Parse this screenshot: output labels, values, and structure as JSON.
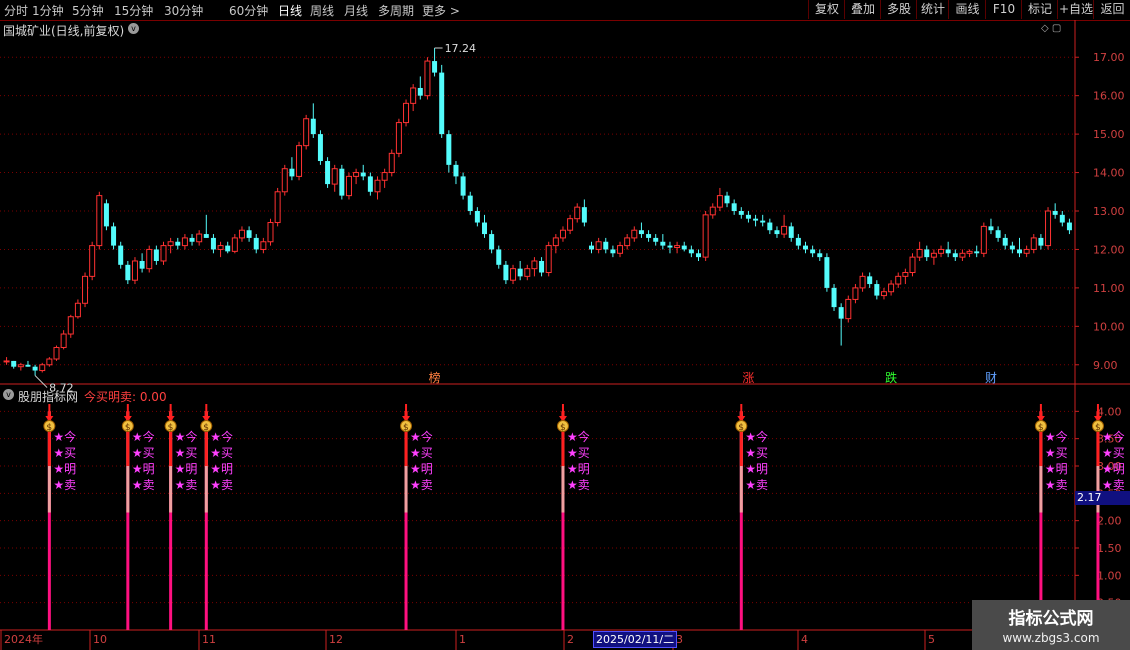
{
  "toolbar": {
    "periods": [
      "分时",
      "1分钟",
      "5分钟",
      "15分钟",
      "30分钟",
      "60分钟",
      "日线",
      "周线",
      "月线",
      "多周期",
      "更多 >"
    ],
    "active_period": "日线",
    "buttons": [
      "复权",
      "叠加",
      "多股",
      "统计",
      "画线",
      "F10",
      "标记",
      "+自选",
      "返回"
    ]
  },
  "stock": {
    "title": "国城矿业(日线,前复权)",
    "toggle": "v"
  },
  "indicator": {
    "name": "股朋指标网",
    "value_text": "今买明卖: 0.00",
    "toggle": "v"
  },
  "corner_icons": "◇ ▢",
  "date_cursor": "2025/02/11/二",
  "value_tag": "2.17",
  "watermark": {
    "title": "指标公式网",
    "url": "www.zbgs3.com"
  },
  "colors": {
    "up": "#ff3232",
    "down": "#54fcfc",
    "grid": "#7a0000",
    "axis": "#cc2020"
  },
  "chart_data": {
    "type": "candlestick",
    "price_axis": {
      "ticks": [
        "17.00",
        "16.00",
        "15.00",
        "14.00",
        "13.00",
        "12.00",
        "11.00",
        "10.00",
        "9.00"
      ],
      "ylim": [
        8.5,
        17.5
      ]
    },
    "indicator_axis": {
      "ticks": [
        "4.00",
        "3.50",
        "3.00",
        "2.50",
        "2.00",
        "1.50",
        "1.00",
        "0.50"
      ],
      "ylim": [
        0,
        4.5
      ]
    },
    "time_axis": [
      "2024年",
      "10",
      "11",
      "12",
      "1",
      "2",
      "3",
      "4",
      "5"
    ],
    "high_label": "17.24",
    "low_label": "8.72",
    "candles": [
      [
        9.1,
        9.2,
        9.0,
        9.1
      ],
      [
        9.1,
        9.1,
        8.9,
        8.95
      ],
      [
        8.95,
        9.05,
        8.85,
        9.0
      ],
      [
        9.0,
        9.1,
        8.95,
        8.95
      ],
      [
        8.95,
        9.0,
        8.72,
        8.85
      ],
      [
        8.85,
        9.05,
        8.8,
        9.0
      ],
      [
        9.0,
        9.2,
        8.95,
        9.15
      ],
      [
        9.15,
        9.5,
        9.1,
        9.45
      ],
      [
        9.45,
        9.9,
        9.4,
        9.8
      ],
      [
        9.8,
        10.3,
        9.7,
        10.25
      ],
      [
        10.25,
        10.7,
        10.2,
        10.6
      ],
      [
        10.6,
        11.4,
        10.5,
        11.3
      ],
      [
        11.3,
        12.2,
        11.2,
        12.1
      ],
      [
        12.1,
        13.5,
        12.0,
        13.4
      ],
      [
        13.2,
        13.3,
        12.5,
        12.6
      ],
      [
        12.6,
        12.7,
        12.0,
        12.1
      ],
      [
        12.1,
        12.2,
        11.5,
        11.6
      ],
      [
        11.6,
        11.7,
        11.1,
        11.2
      ],
      [
        11.2,
        11.8,
        11.1,
        11.7
      ],
      [
        11.7,
        11.9,
        11.4,
        11.5
      ],
      [
        11.5,
        12.1,
        11.4,
        12.0
      ],
      [
        12.0,
        12.1,
        11.6,
        11.7
      ],
      [
        11.7,
        12.2,
        11.6,
        12.1
      ],
      [
        12.1,
        12.3,
        11.9,
        12.2
      ],
      [
        12.2,
        12.3,
        12.0,
        12.1
      ],
      [
        12.1,
        12.4,
        12.0,
        12.3
      ],
      [
        12.3,
        12.4,
        12.1,
        12.2
      ],
      [
        12.2,
        12.5,
        12.1,
        12.4
      ],
      [
        12.4,
        12.9,
        12.3,
        12.3
      ],
      [
        12.3,
        12.4,
        11.9,
        12.0
      ],
      [
        12.0,
        12.2,
        11.8,
        12.1
      ],
      [
        12.1,
        12.2,
        11.9,
        11.95
      ],
      [
        11.95,
        12.4,
        11.9,
        12.3
      ],
      [
        12.3,
        12.6,
        12.2,
        12.5
      ],
      [
        12.5,
        12.6,
        12.2,
        12.3
      ],
      [
        12.3,
        12.4,
        11.9,
        12.0
      ],
      [
        12.0,
        12.3,
        11.9,
        12.2
      ],
      [
        12.2,
        12.8,
        12.1,
        12.7
      ],
      [
        12.7,
        13.6,
        12.6,
        13.5
      ],
      [
        13.5,
        14.2,
        13.4,
        14.1
      ],
      [
        14.1,
        14.4,
        13.8,
        13.9
      ],
      [
        13.9,
        14.8,
        13.8,
        14.7
      ],
      [
        14.7,
        15.5,
        14.6,
        15.4
      ],
      [
        15.4,
        15.8,
        14.9,
        15.0
      ],
      [
        15.0,
        15.1,
        14.2,
        14.3
      ],
      [
        14.3,
        14.4,
        13.6,
        13.7
      ],
      [
        13.7,
        14.2,
        13.5,
        14.1
      ],
      [
        14.1,
        14.2,
        13.3,
        13.4
      ],
      [
        13.4,
        14.0,
        13.3,
        13.9
      ],
      [
        13.9,
        14.1,
        13.7,
        14.0
      ],
      [
        14.0,
        14.2,
        13.8,
        13.9
      ],
      [
        13.9,
        14.0,
        13.4,
        13.5
      ],
      [
        13.5,
        13.9,
        13.3,
        13.8
      ],
      [
        13.8,
        14.1,
        13.6,
        14.0
      ],
      [
        14.0,
        14.6,
        13.9,
        14.5
      ],
      [
        14.5,
        15.4,
        14.4,
        15.3
      ],
      [
        15.3,
        15.9,
        15.2,
        15.8
      ],
      [
        15.8,
        16.3,
        15.6,
        16.2
      ],
      [
        16.2,
        16.5,
        15.9,
        16.0
      ],
      [
        16.0,
        17.0,
        15.9,
        16.9
      ],
      [
        16.9,
        17.24,
        16.5,
        16.6
      ],
      [
        16.6,
        16.8,
        14.9,
        15.0
      ],
      [
        15.0,
        15.1,
        14.0,
        14.2
      ],
      [
        14.2,
        14.3,
        13.7,
        13.9
      ],
      [
        13.9,
        14.0,
        13.3,
        13.4
      ],
      [
        13.4,
        13.5,
        12.9,
        13.0
      ],
      [
        13.0,
        13.1,
        12.6,
        12.7
      ],
      [
        12.7,
        12.9,
        12.3,
        12.4
      ],
      [
        12.4,
        12.5,
        11.9,
        12.0
      ],
      [
        12.0,
        12.1,
        11.5,
        11.6
      ],
      [
        11.6,
        11.7,
        11.1,
        11.2
      ],
      [
        11.2,
        11.6,
        11.1,
        11.5
      ],
      [
        11.5,
        11.7,
        11.2,
        11.3
      ],
      [
        11.3,
        11.6,
        11.2,
        11.5
      ],
      [
        11.5,
        11.8,
        11.3,
        11.7
      ],
      [
        11.7,
        11.8,
        11.3,
        11.4
      ],
      [
        11.4,
        12.2,
        11.3,
        12.1
      ],
      [
        12.1,
        12.4,
        11.9,
        12.3
      ],
      [
        12.3,
        12.6,
        12.2,
        12.5
      ],
      [
        12.5,
        12.9,
        12.4,
        12.8
      ],
      [
        12.8,
        13.2,
        12.7,
        13.1
      ],
      [
        13.1,
        13.3,
        12.6,
        12.7
      ]
    ],
    "candles_tail": [
      [
        12.1,
        12.2,
        11.9,
        12.0
      ],
      [
        12.0,
        12.3,
        11.9,
        12.2
      ],
      [
        12.2,
        12.3,
        11.9,
        12.0
      ],
      [
        12.0,
        12.1,
        11.8,
        11.9
      ],
      [
        11.9,
        12.2,
        11.8,
        12.1
      ],
      [
        12.1,
        12.4,
        12.0,
        12.3
      ],
      [
        12.3,
        12.6,
        12.2,
        12.5
      ],
      [
        12.5,
        12.7,
        12.3,
        12.4
      ],
      [
        12.4,
        12.5,
        12.2,
        12.3
      ],
      [
        12.3,
        12.4,
        12.1,
        12.2
      ],
      [
        12.2,
        12.4,
        12.0,
        12.1
      ],
      [
        12.1,
        12.2,
        11.9,
        12.05
      ],
      [
        12.05,
        12.2,
        11.9,
        12.1
      ],
      [
        12.1,
        12.2,
        11.95,
        12.0
      ],
      [
        12.0,
        12.1,
        11.8,
        11.9
      ],
      [
        11.9,
        12.0,
        11.7,
        11.8
      ],
      [
        11.8,
        13.0,
        11.7,
        12.9
      ],
      [
        12.9,
        13.2,
        12.8,
        13.1
      ],
      [
        13.1,
        13.6,
        13.0,
        13.4
      ],
      [
        13.4,
        13.5,
        13.1,
        13.2
      ],
      [
        13.2,
        13.3,
        12.9,
        13.0
      ],
      [
        13.0,
        13.1,
        12.8,
        12.9
      ],
      [
        12.9,
        13.0,
        12.7,
        12.8
      ],
      [
        12.8,
        12.9,
        12.6,
        12.75
      ],
      [
        12.75,
        12.9,
        12.6,
        12.7
      ],
      [
        12.7,
        12.8,
        12.4,
        12.5
      ],
      [
        12.5,
        12.6,
        12.3,
        12.4
      ],
      [
        12.4,
        12.9,
        12.3,
        12.6
      ],
      [
        12.6,
        12.7,
        12.2,
        12.3
      ],
      [
        12.3,
        12.4,
        12.0,
        12.1
      ],
      [
        12.1,
        12.2,
        11.9,
        12.0
      ],
      [
        12.0,
        12.1,
        11.8,
        11.9
      ],
      [
        11.9,
        12.0,
        11.7,
        11.8
      ],
      [
        11.8,
        11.9,
        10.9,
        11.0
      ],
      [
        11.0,
        11.1,
        10.4,
        10.5
      ],
      [
        10.5,
        10.6,
        9.5,
        10.2
      ],
      [
        10.2,
        10.8,
        10.1,
        10.7
      ],
      [
        10.7,
        11.1,
        10.6,
        11.0
      ],
      [
        11.0,
        11.4,
        10.9,
        11.3
      ],
      [
        11.3,
        11.4,
        11.0,
        11.1
      ],
      [
        11.1,
        11.2,
        10.7,
        10.8
      ],
      [
        10.8,
        11.0,
        10.7,
        10.9
      ],
      [
        10.9,
        11.2,
        10.8,
        11.1
      ],
      [
        11.1,
        11.4,
        11.0,
        11.3
      ],
      [
        11.3,
        11.5,
        11.1,
        11.4
      ],
      [
        11.4,
        11.9,
        11.3,
        11.8
      ],
      [
        11.8,
        12.2,
        11.7,
        12.0
      ],
      [
        12.0,
        12.1,
        11.7,
        11.8
      ],
      [
        11.8,
        12.0,
        11.6,
        11.9
      ],
      [
        11.9,
        12.1,
        11.8,
        12.0
      ],
      [
        12.0,
        12.2,
        11.8,
        11.9
      ],
      [
        11.9,
        12.0,
        11.7,
        11.8
      ],
      [
        11.8,
        12.0,
        11.7,
        11.9
      ],
      [
        11.9,
        12.0,
        11.8,
        11.95
      ],
      [
        11.95,
        12.1,
        11.8,
        11.9
      ],
      [
        11.9,
        12.7,
        11.8,
        12.6
      ],
      [
        12.6,
        12.8,
        12.4,
        12.5
      ],
      [
        12.5,
        12.6,
        12.2,
        12.3
      ],
      [
        12.3,
        12.4,
        12.0,
        12.1
      ],
      [
        12.1,
        12.2,
        11.9,
        12.0
      ],
      [
        12.0,
        12.3,
        11.8,
        11.9
      ],
      [
        11.9,
        12.1,
        11.8,
        12.0
      ],
      [
        12.0,
        12.4,
        11.9,
        12.3
      ],
      [
        12.3,
        12.4,
        12.0,
        12.1
      ],
      [
        12.1,
        13.1,
        12.0,
        13.0
      ],
      [
        13.0,
        13.2,
        12.8,
        12.9
      ],
      [
        12.9,
        13.0,
        12.6,
        12.7
      ],
      [
        12.7,
        12.8,
        12.4,
        12.5
      ]
    ],
    "signals": {
      "candle_index": [
        6,
        17,
        23,
        28,
        56,
        78,
        103,
        145,
        153
      ],
      "value": 4.0,
      "labels": [
        "★今",
        "★买",
        "★明",
        "★卖"
      ]
    },
    "event_marks": [
      {
        "text": "榜",
        "candle_index": 60,
        "color": "#ff8040"
      },
      {
        "text": "涨",
        "candle_index": 104,
        "color": "#ff3030"
      },
      {
        "text": "跌",
        "candle_index": 124,
        "color": "#30ff30"
      },
      {
        "text": "财",
        "candle_index": 138,
        "color": "#60a0ff"
      }
    ]
  }
}
